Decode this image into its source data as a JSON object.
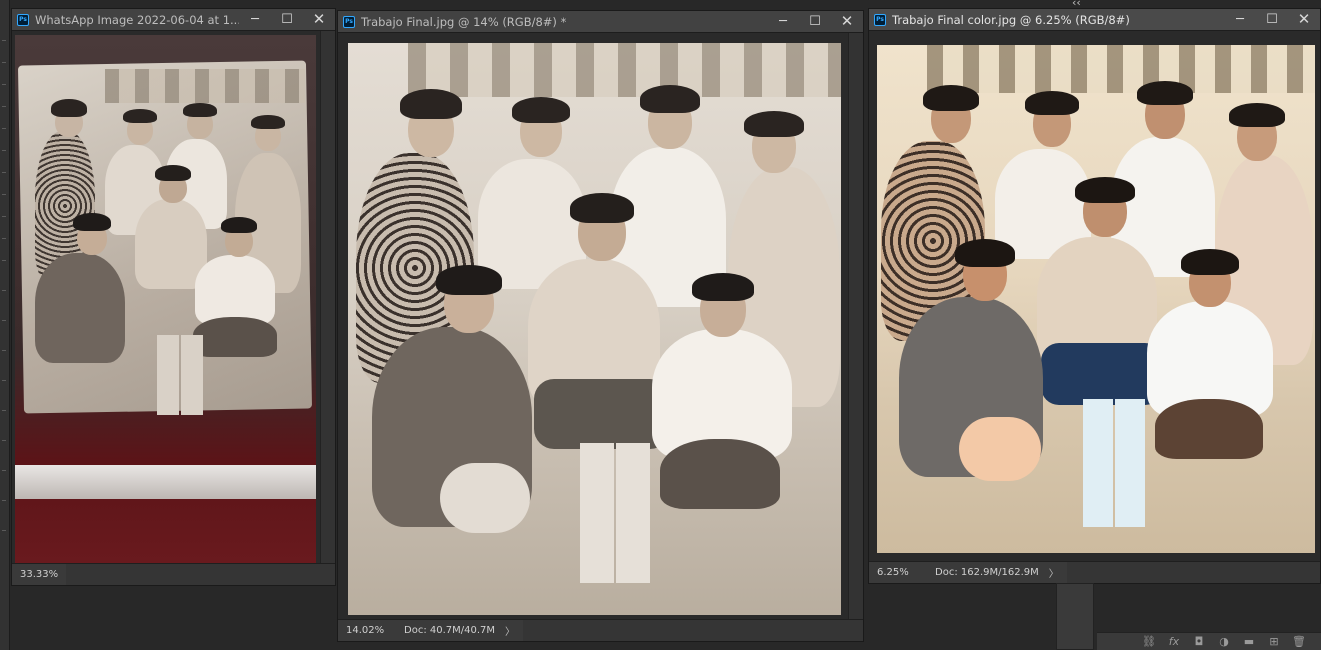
{
  "windows": [
    {
      "title": "WhatsApp Image 2022-06-04 at 1...",
      "zoom": "33.33%",
      "doc_info": ""
    },
    {
      "title": "Trabajo Final.jpg @ 14% (RGB/8#) *",
      "zoom": "14.02%",
      "doc_info": "Doc: 40.7M/40.7M"
    },
    {
      "title": "Trabajo Final color.jpg @ 6.25% (RGB/8#)",
      "zoom": "6.25%",
      "doc_info": "Doc: 162.9M/162.9M"
    }
  ],
  "controls": {
    "minimize": "─",
    "maximize": "☐",
    "close": "✕",
    "ps_badge": "Ps",
    "status_arrow": "〉",
    "collapse": "‹‹"
  },
  "panel_icons": [
    "link-icon",
    "fx-icon",
    "mask-icon",
    "adjustment-icon",
    "folder-icon",
    "new-layer-icon",
    "trash-icon"
  ],
  "panel_glyphs": [
    "⛓",
    "fx",
    "◘",
    "◑",
    "▬",
    "⊞",
    "🗑"
  ],
  "colors": {
    "workspace": "#282828",
    "titlebar": "#424242",
    "active_titlebar": "#4a4a4a",
    "ps_blue": "#31a8ff"
  }
}
